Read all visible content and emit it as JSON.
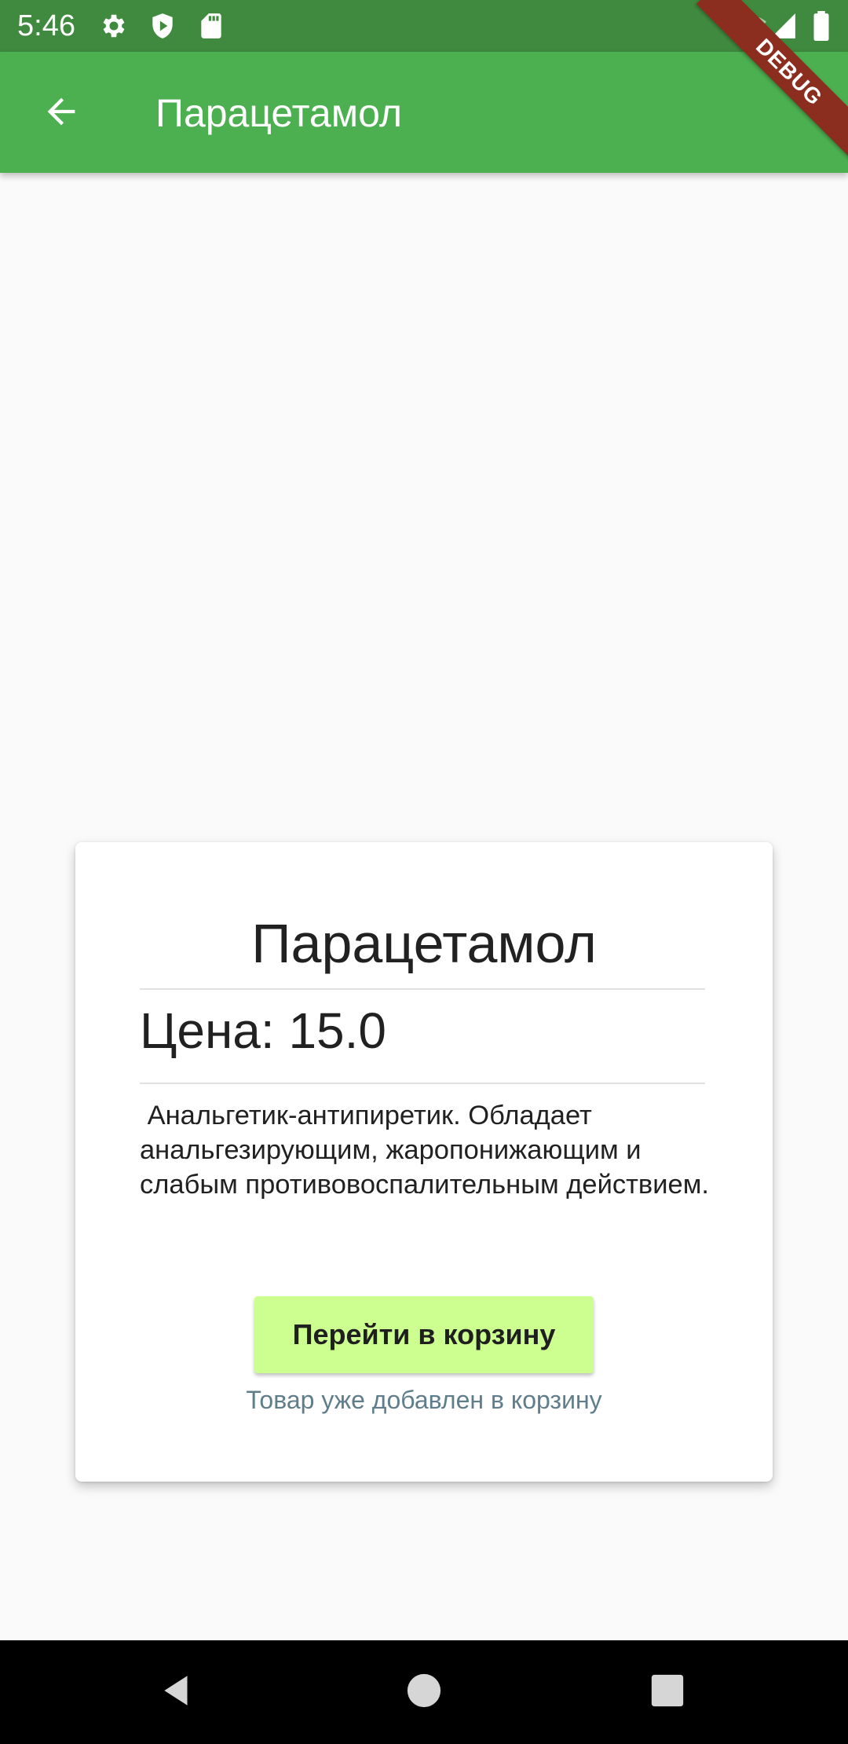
{
  "status_bar": {
    "time": "5:46",
    "icons": [
      "gear-icon",
      "shield-icon",
      "sd-card-icon",
      "wifi-off-icon",
      "signal-icon",
      "battery-icon"
    ]
  },
  "app_bar": {
    "title": "Парацетамол",
    "back_icon": "arrow-back-icon",
    "color": "#4caf50"
  },
  "debug_banner": "DEBUG",
  "card": {
    "title": "Парацетамол",
    "price": "Цена: 15.0",
    "description": " Анальгетик-антипиретик. Обладает анальгезирующим, жаропонижающим и слабым противовоспалительным действием.",
    "button_label": "Перейти в корзину",
    "button_color": "#ccff90",
    "status_text": "Товар уже добавлен в корзину"
  },
  "nav_bar": {
    "back_icon": "nav-back-icon",
    "home_icon": "nav-home-icon",
    "recents_icon": "nav-recents-icon"
  }
}
